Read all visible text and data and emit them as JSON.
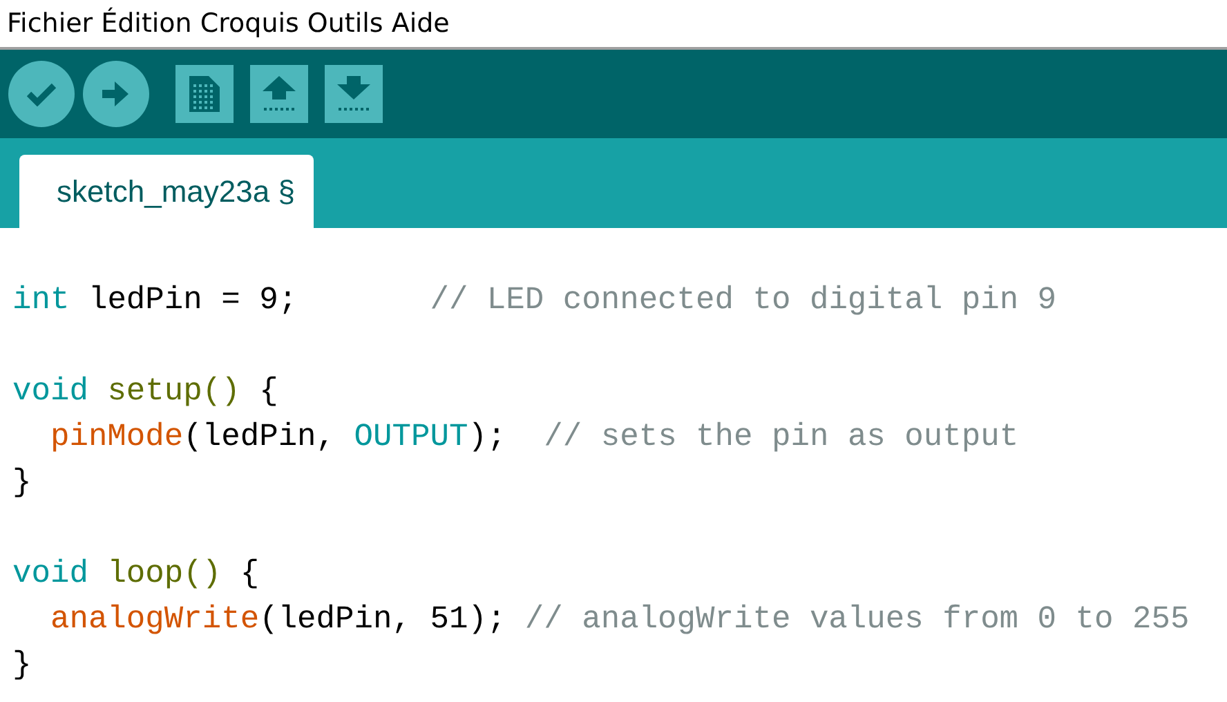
{
  "menu": [
    "Fichier",
    "Édition",
    "Croquis",
    "Outils",
    "Aide"
  ],
  "toolbar": [
    {
      "kind": "verify"
    },
    {
      "kind": "upload"
    },
    {
      "kind": "new"
    },
    {
      "kind": "open"
    },
    {
      "kind": "save"
    }
  ],
  "tabs": [
    {
      "label": "sketch_may23a §",
      "selected": true
    }
  ],
  "code_blocks": [
    [
      [
        {
          "text": "int",
          "kind": "keyword"
        },
        {
          "text": " ledPin = 9;",
          "kind": "plain"
        },
        {
          "text": "       // LED connected to digital pin 9",
          "kind": "comment"
        }
      ]
    ],
    [
      [
        {
          "text": "void",
          "kind": "keyword"
        },
        {
          "text": " setup()",
          "kind": "structure"
        },
        {
          "text": " {",
          "kind": "plain"
        }
      ],
      [
        {
          "text": "  pinMode",
          "kind": "function"
        },
        {
          "text": "(ledPin, ",
          "kind": "plain"
        },
        {
          "text": "OUTPUT",
          "kind": "keyword"
        },
        {
          "text": ");",
          "kind": "plain"
        },
        {
          "text": "  // sets the pin as output",
          "kind": "comment"
        }
      ],
      [
        {
          "text": "}",
          "kind": "plain"
        }
      ]
    ],
    [
      [
        {
          "text": "void",
          "kind": "keyword"
        },
        {
          "text": " loop()",
          "kind": "structure"
        },
        {
          "text": " {",
          "kind": "plain"
        }
      ],
      [
        {
          "text": "  analogWrite",
          "kind": "function"
        },
        {
          "text": "(ledPin, 51);",
          "kind": "plain"
        },
        {
          "text": " // analogWrite values from 0 to 255",
          "kind": "comment"
        }
      ],
      [
        {
          "text": "}",
          "kind": "plain"
        }
      ]
    ]
  ]
}
